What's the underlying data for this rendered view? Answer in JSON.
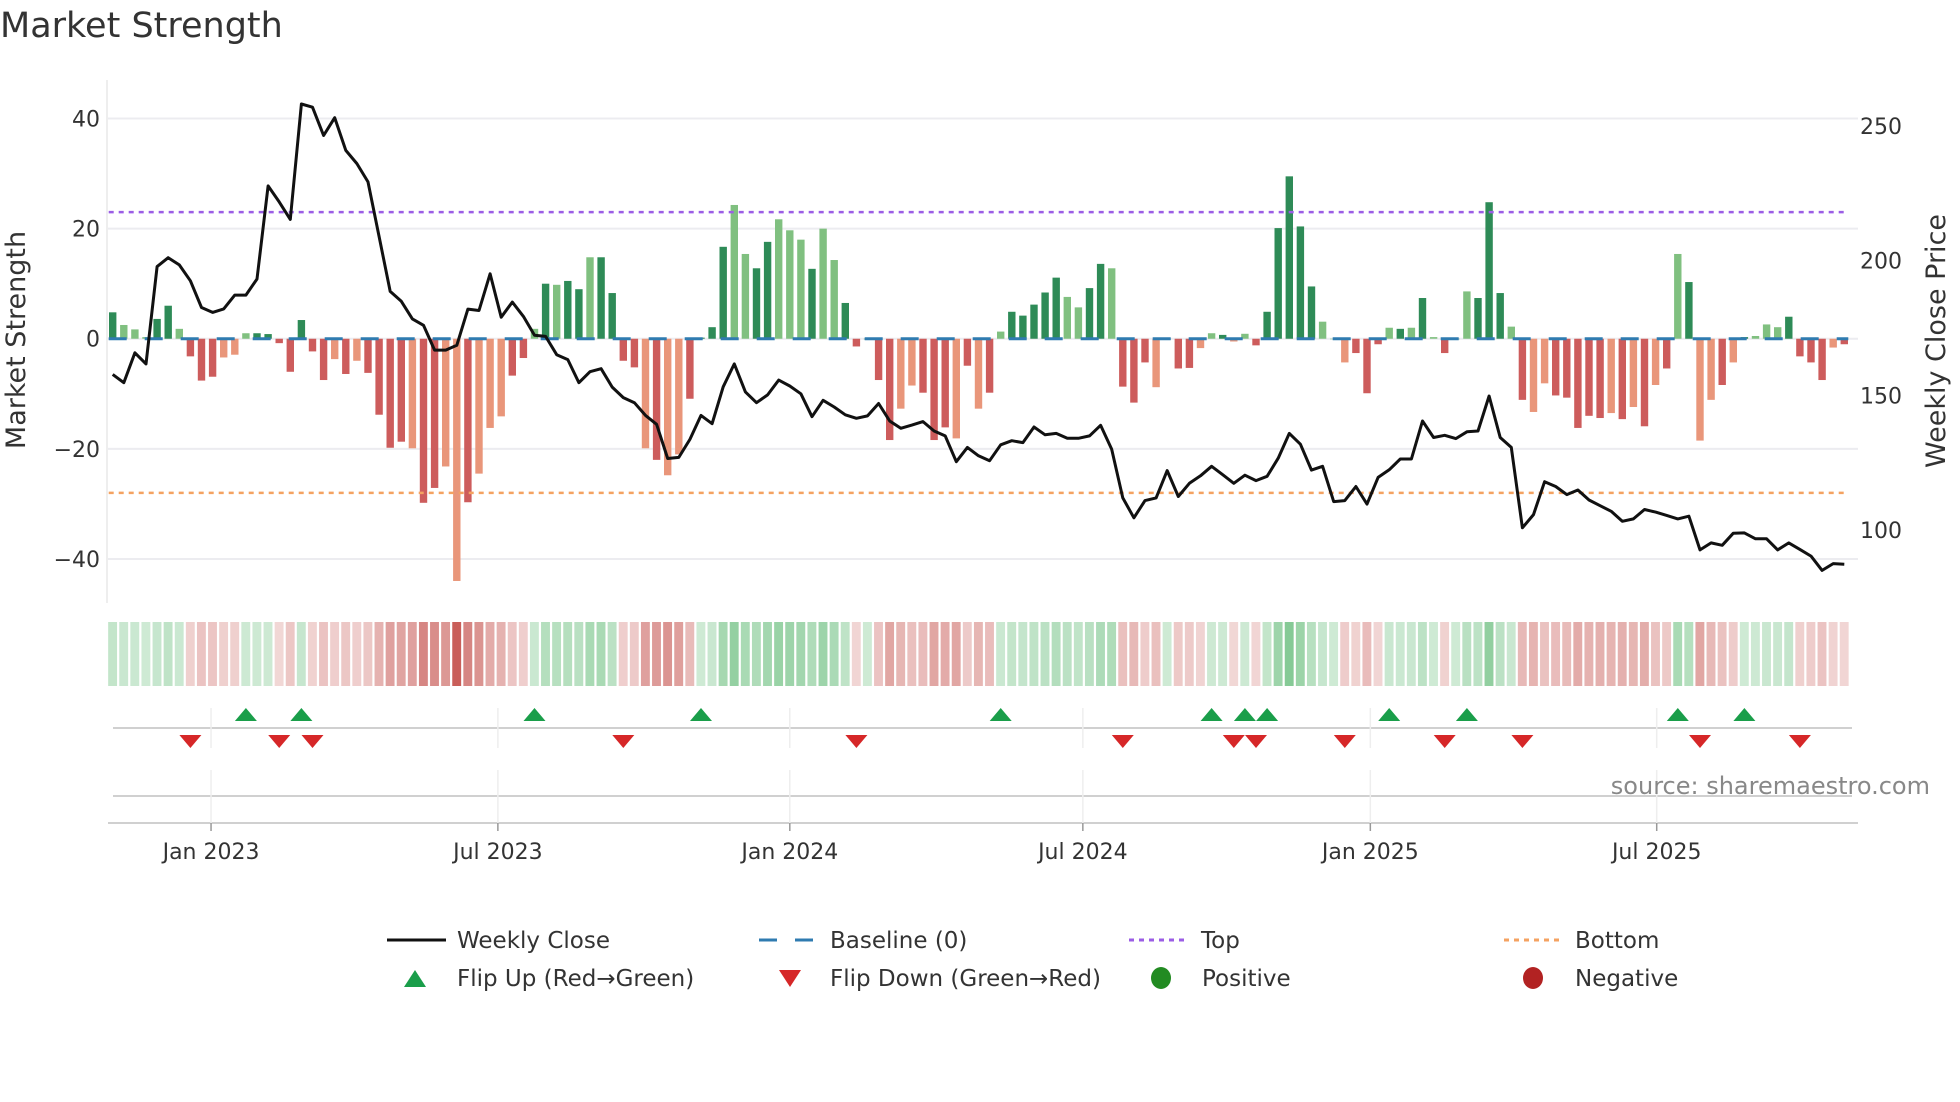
{
  "title": "Market Strength",
  "source": "source: sharemaestro.com",
  "colors": {
    "pos_dark": "#2e8b57",
    "pos_light": "#80c080",
    "neg_dark": "#cd5c5c",
    "neg_light": "#e9967a",
    "baseline": "#2f7bb0",
    "top": "#9b5de5",
    "bottom": "#f4a261",
    "price": "#111111",
    "flip_up": "#1a9e4a",
    "flip_down": "#d62728",
    "positive": "#228b22",
    "negative": "#b22222"
  },
  "legend": {
    "weekly_close": "Weekly Close",
    "baseline": "Baseline (0)",
    "top": "Top",
    "bottom": "Bottom",
    "flip_up": "Flip Up (Red→Green)",
    "flip_down": "Flip Down (Green→Red)",
    "positive": "Positive",
    "negative": "Negative"
  },
  "chart_data": {
    "type": "bar",
    "title": "Market Strength",
    "ylabel": "Market Strength",
    "ylabel_right": "Weekly Close Price",
    "ylim": [
      -48,
      47
    ],
    "ylim_right": [
      73,
      267
    ],
    "yticks": [
      40,
      20,
      0,
      -20,
      -40
    ],
    "yticks_right": [
      250,
      200,
      150,
      100
    ],
    "top_level": 23,
    "bottom_level": -28,
    "baseline": 0,
    "grid": true,
    "x_unit": "week index",
    "xticks": [
      {
        "label": "Jan 2023",
        "week": 8.86
      },
      {
        "label": "Jul 2023",
        "week": 34.7
      },
      {
        "label": "Jan 2024",
        "week": 61.0
      },
      {
        "label": "Jul 2024",
        "week": 87.4
      },
      {
        "label": "Jan 2025",
        "week": 113.3
      },
      {
        "label": "Jul 2025",
        "week": 139.1
      }
    ],
    "strength": [
      4.8,
      2.5,
      1.7,
      0.3,
      3.6,
      6,
      1.8,
      -3.2,
      -7.6,
      -6.9,
      -3.4,
      -2.9,
      1,
      1,
      0.85,
      -0.8,
      -6,
      3.4,
      -2.3,
      -7.5,
      -3.7,
      -6.4,
      -4,
      -6.2,
      -13.8,
      -19.8,
      -18.7,
      -19.9,
      -29.8,
      -27.1,
      -23.2,
      -44,
      -29.7,
      -24.5,
      -16.2,
      -14.1,
      -6.7,
      -3.5,
      1.8,
      10,
      9.8,
      10.5,
      9,
      14.8,
      14.8,
      8.3,
      -4,
      -5.2,
      -19.9,
      -22,
      -24.8,
      -21,
      -10.9,
      0.2,
      2.1,
      16.7,
      24.3,
      15.4,
      12.8,
      17.6,
      21.7,
      19.7,
      18,
      12.7,
      20,
      14.3,
      6.5,
      -1.4,
      0,
      -7.5,
      -18.4,
      -12.7,
      -8.5,
      -9.8,
      -18.4,
      -16.1,
      -18.1,
      -4.9,
      -12.7,
      -9.8,
      1.3,
      4.9,
      4.2,
      6.2,
      8.4,
      11.1,
      7.6,
      5.7,
      9.2,
      13.6,
      12.8,
      -8.7,
      -11.6,
      -4.3,
      -8.8,
      0,
      -5.4,
      -5.3,
      -1.7,
      1,
      0.7,
      -0.5,
      0.9,
      -1.2,
      4.9,
      20.1,
      29.5,
      20.4,
      9.5,
      3.1,
      0,
      -4.3,
      -2.6,
      -9.9,
      -1,
      2,
      1.8,
      2,
      7.4,
      0.3,
      -2.6,
      0,
      8.6,
      7.4,
      24.8,
      8.3,
      2.2,
      -11.1,
      -13.3,
      -8.1,
      -10.3,
      -10.7,
      -16.2,
      -14,
      -14.4,
      -13.5,
      -14.6,
      -12.4,
      -15.9,
      -8.4,
      -5.4,
      15.4,
      10.3,
      -18.5,
      -11.1,
      -8.4,
      -4.3,
      0.3,
      0.5,
      2.6,
      2.1,
      4,
      -3.2,
      -4.3,
      -7.5,
      -1.6,
      -1
    ],
    "shade": "dlllddldddllldddddddldlddddlddlldlllddldlddlddddldllddddllddllldlldddddlldddldldldddddllddldddldddlldllddddddllldddldldlddldddldlldddddldldldldlldldlllddddlddddll",
    "price": [
      157.8,
      154.7,
      165.8,
      161.7,
      197.8,
      201.1,
      198.4,
      192.5,
      182.6,
      180.8,
      182.1,
      187.2,
      187.2,
      193.2,
      227.7,
      221.8,
      215.3,
      258.1,
      256.9,
      246.4,
      253,
      240.9,
      236,
      229.2,
      208.9,
      188.6,
      184.9,
      178.4,
      176,
      166.8,
      166.8,
      168.6,
      182,
      181.5,
      195.1,
      179,
      184.6,
      179.3,
      172.3,
      171.9,
      165.1,
      163.3,
      154.7,
      158.8,
      159.9,
      153.1,
      149.2,
      147.3,
      142.6,
      139.3,
      126.6,
      127,
      133.7,
      142.6,
      139.5,
      153.2,
      161.7,
      151.3,
      147.3,
      150.2,
      155.7,
      153.5,
      150.6,
      142.1,
      148.2,
      145.7,
      142.8,
      141.5,
      142.4,
      147,
      140.5,
      137.8,
      139,
      140.3,
      136.8,
      135,
      125.4,
      130.7,
      127.6,
      125.8,
      131.7,
      133.2,
      132.5,
      138.3,
      135.4,
      135.9,
      134.1,
      134.1,
      135,
      138.9,
      130,
      112,
      104.6,
      111,
      112,
      122.1,
      112.5,
      117.4,
      120.2,
      123.7,
      120.6,
      117.4,
      120.4,
      118.4,
      120,
      126.7,
      135.9,
      131.9,
      122.3,
      123.7,
      110.6,
      111,
      116.2,
      109.7,
      119.6,
      122.4,
      126.4,
      126.4,
      140.5,
      134.4,
      135.2,
      134,
      136.5,
      136.8,
      149.8,
      134.4,
      130.7,
      100.9,
      105.8,
      118,
      116.2,
      113.2,
      114.9,
      111.2,
      109.1,
      107,
      103.3,
      104.2,
      107.7,
      106.7,
      105.5,
      104.2,
      105.2,
      92.7,
      95.3,
      94.4,
      98.9,
      99,
      96.8,
      96.8,
      92.7,
      95.3,
      92.9,
      90.4,
      85.1,
      87.6,
      87.4
    ],
    "flip_up_weeks": [
      12,
      17,
      38,
      53,
      80,
      99,
      102,
      104,
      115,
      122,
      141,
      147
    ],
    "flip_down_weeks": [
      7,
      15,
      18,
      46,
      67,
      91,
      101,
      103,
      111,
      120,
      127,
      143,
      152
    ],
    "legend_position": "bottom-center"
  }
}
